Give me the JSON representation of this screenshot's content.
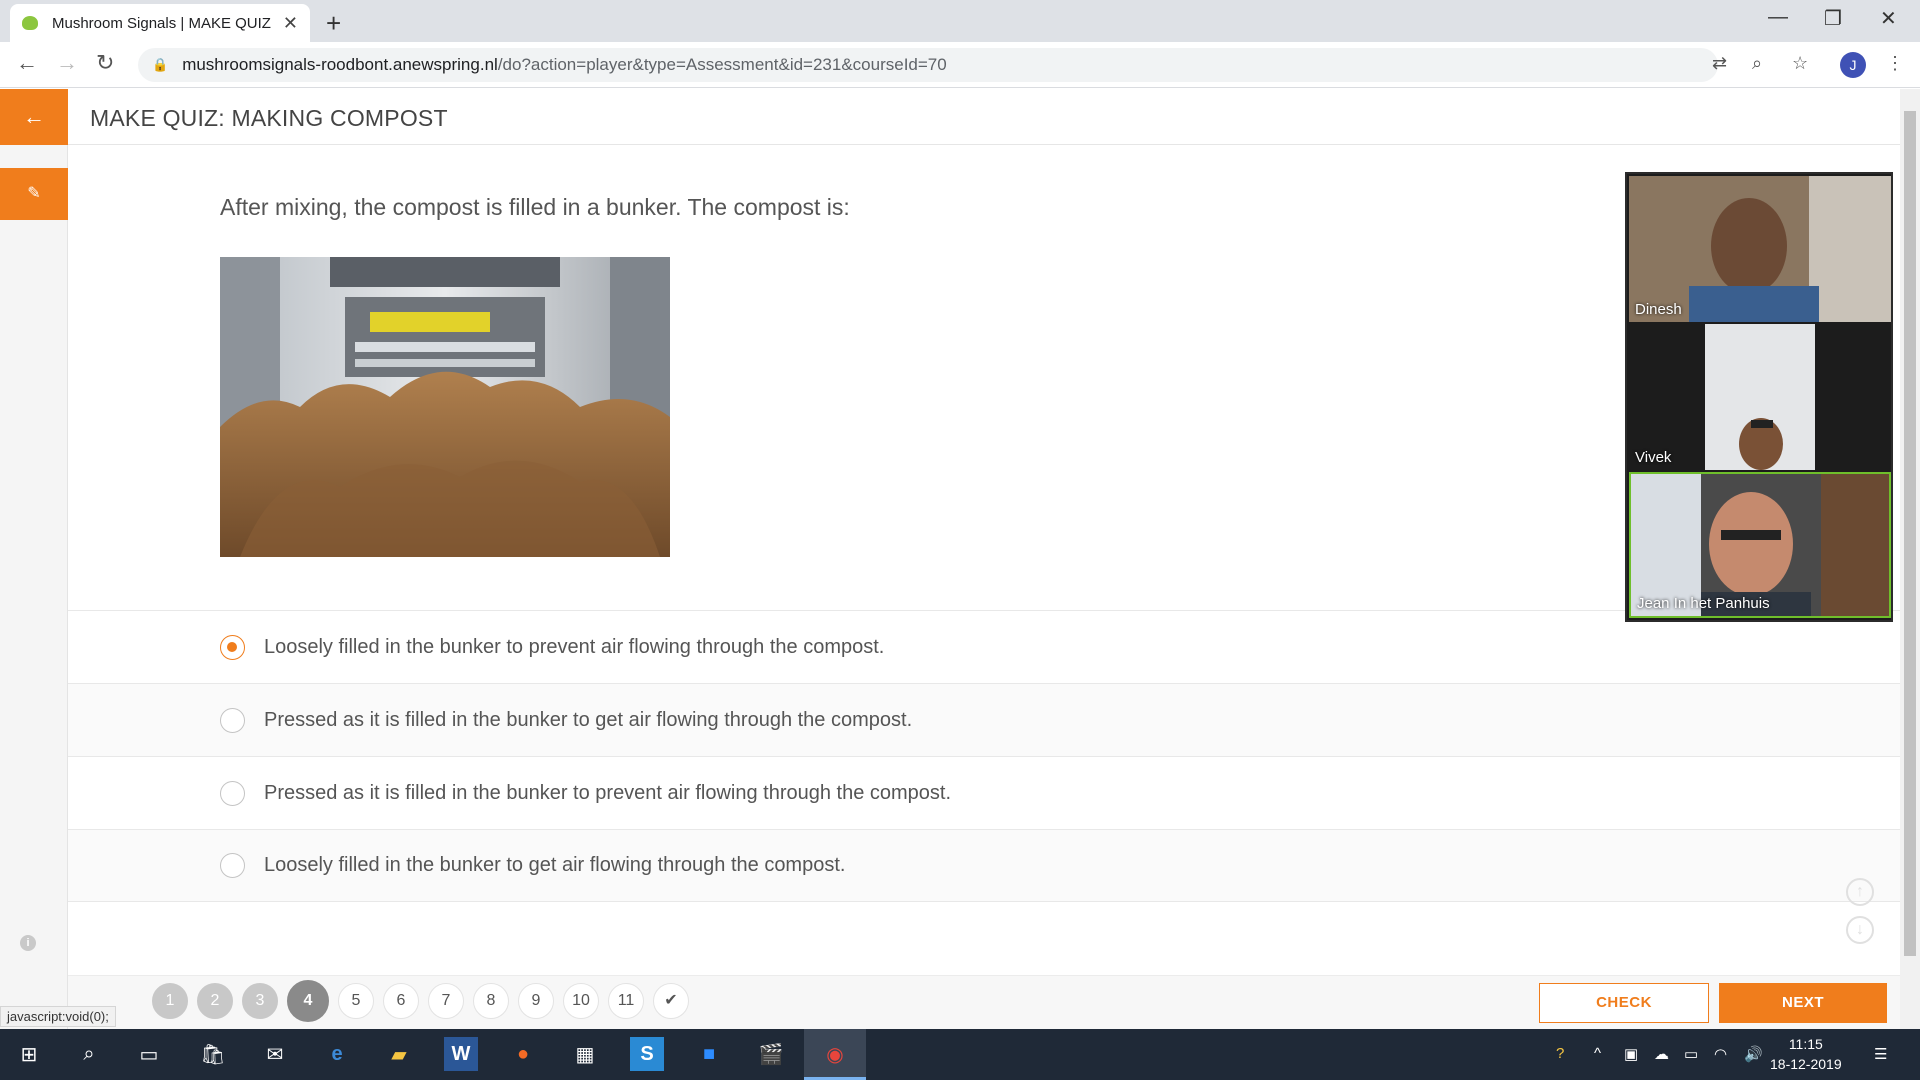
{
  "browser": {
    "tab_title": "Mushroom Signals | MAKE QUIZ",
    "url_domain": "mushroomsignals-roodbont.anewspring.nl",
    "url_path": "/do?action=player&type=Assessment&id=231&courseId=70",
    "profile_initial": "J",
    "status_link": "javascript:void(0);"
  },
  "page": {
    "title": "MAKE QUIZ: MAKING COMPOST",
    "question": "After mixing, the compost is filled in a bunker. The compost is:"
  },
  "answers": [
    {
      "text": "Loosely filled in the bunker to prevent air flowing through the compost.",
      "selected": true
    },
    {
      "text": "Pressed as it is filled in the bunker to get air flowing through the compost.",
      "selected": false
    },
    {
      "text": "Pressed as it is filled in the bunker to prevent air flowing through the compost.",
      "selected": false
    },
    {
      "text": "Loosely filled in the bunker to get air flowing through the compost.",
      "selected": false
    }
  ],
  "pager": {
    "pages": [
      "1",
      "2",
      "3",
      "4",
      "5",
      "6",
      "7",
      "8",
      "9",
      "10",
      "11"
    ],
    "current": "4",
    "finish_icon": "check-icon"
  },
  "buttons": {
    "check": "CHECK",
    "next": "NEXT"
  },
  "video_call": {
    "participants": [
      "Dinesh",
      "Vivek",
      "Jean In het Panhuis"
    ]
  },
  "taskbar": {
    "time": "11:15",
    "date": "18-12-2019"
  },
  "colors": {
    "accent": "#f07d1c",
    "taskbar": "#1f2937"
  }
}
